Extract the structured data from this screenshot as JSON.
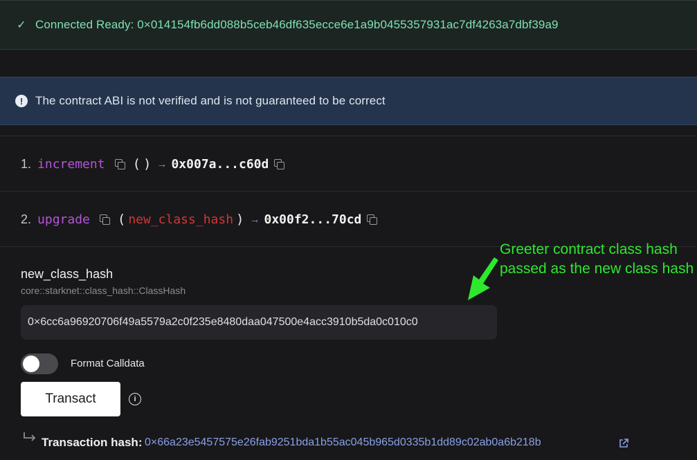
{
  "status": {
    "icon": "check-icon",
    "text": "Connected Ready: 0×014154fb6dd088b5ceb46df635ecce6e1a9b0455357931ac7df4263a7dbf39a9",
    "color": "#7fe1b4"
  },
  "warning": {
    "icon": "info-icon",
    "text": "The contract ABI is not verified and is not guaranteed to be correct"
  },
  "functions": [
    {
      "number": "1.",
      "name": "increment",
      "open_paren": "(",
      "param": "",
      "close_paren": ")",
      "arrow": "→",
      "selector": "0x007a...c60d"
    },
    {
      "number": "2.",
      "name": "upgrade",
      "open_paren": "(",
      "param": "new_class_hash",
      "close_paren": ")",
      "arrow": "→",
      "selector": "0x00f2...70cd"
    }
  ],
  "form": {
    "field_label": "new_class_hash",
    "field_type": "core::starknet::class_hash::ClassHash",
    "field_value": "0×6cc6a96920706f49a5579a2c0f235e8480daa047500e4acc3910b5da0c010c0",
    "toggle_label": "Format Calldata",
    "toggle_on": false,
    "button_label": "Transact"
  },
  "annotation": {
    "text": "Greeter contract class hash passed as the new class hash",
    "color": "#2ee82e"
  },
  "transaction": {
    "label": "Transaction hash:",
    "hash": "0×66a23e5457575e26fab9251bda1b55ac045b965d0335b1dd89c02ab0a6b218b"
  },
  "colors": {
    "function_name": "#b654d8",
    "param_name": "#d43636",
    "link": "#8aa0e6"
  }
}
